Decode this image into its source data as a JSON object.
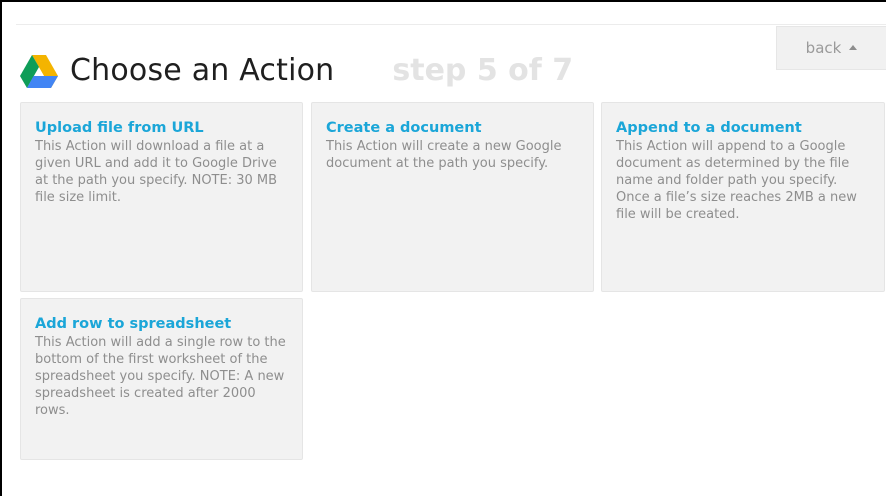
{
  "header": {
    "title": "Choose an Action",
    "step": "step 5 of 7",
    "back_label": "back"
  },
  "icons": {
    "service_logo": "google-drive-icon",
    "back_caret": "caret-up-icon"
  },
  "colors": {
    "card_title": "#1ba6d8",
    "card_bg": "#f2f2f2",
    "card_text": "#8e8e8e",
    "step_text": "#e3e3e3",
    "drive_green": "#0f9d58",
    "drive_yellow": "#f4b400",
    "drive_blue": "#4285f4"
  },
  "actions": [
    {
      "title": "Upload file from URL",
      "description": "This Action will download a file at a given URL and add it to Google Drive at the path you specify. NOTE: 30 MB file size limit."
    },
    {
      "title": "Create a document",
      "description": "This Action will create a new Google document at the path you specify."
    },
    {
      "title": "Append to a document",
      "description": "This Action will append to a Google document as determined by the file name and folder path you specify. Once a file’s size reaches 2MB a new file will be created."
    },
    {
      "title": "Add row to spreadsheet",
      "description": "This Action will add a single row to the bottom of the first worksheet of the spreadsheet you specify. NOTE: A new spreadsheet is created after 2000 rows."
    }
  ]
}
